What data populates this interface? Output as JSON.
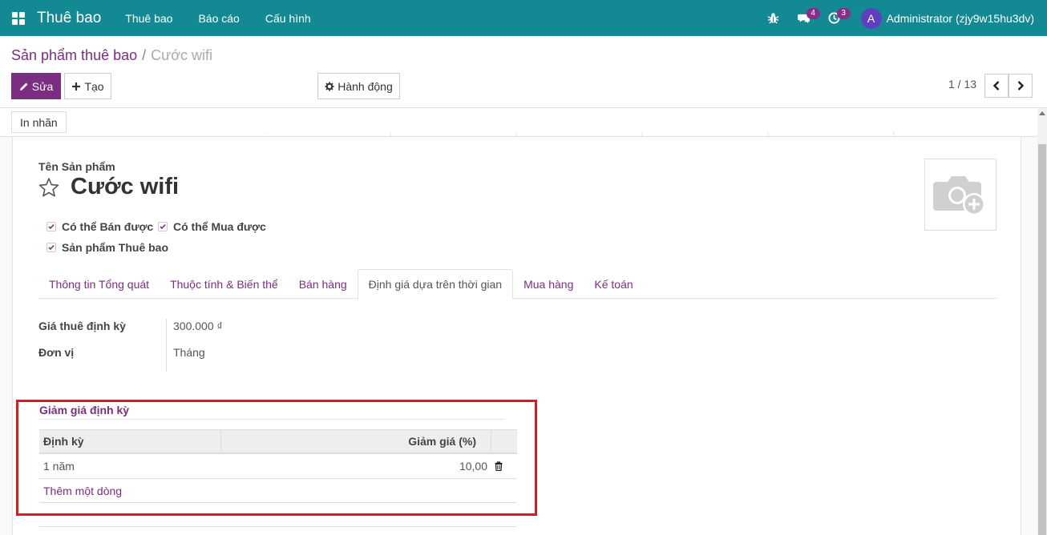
{
  "app": {
    "title": "Thuê bao",
    "menu": [
      "Thuê bao",
      "Báo cáo",
      "Cấu hình"
    ],
    "notifications": {
      "messages": "4",
      "activities": "3"
    },
    "user": {
      "initial": "A",
      "name": "Administrator (zjy9w15hu3dv)"
    },
    "colors": {
      "navbar": "#138a93",
      "primary": "#7c2d82",
      "highlight": "#e3161c"
    }
  },
  "breadcrumb": {
    "parent": "Sản phẩm thuê bao",
    "separator": "/",
    "current": "Cước wifi"
  },
  "toolbar": {
    "edit_label": "Sửa",
    "create_label": "Tạo",
    "action_label": "Hành động"
  },
  "pager": {
    "value": "1 / 13"
  },
  "statusbar": {
    "print_label": "In nhãn"
  },
  "form": {
    "name_label": "Tên Sản phẩm",
    "name": "Cước wifi",
    "checkboxes": [
      {
        "label": "Có thể Bán được",
        "checked": true
      },
      {
        "label": "Có thể Mua được",
        "checked": true
      },
      {
        "label": "Sản phẩm Thuê bao",
        "checked": true
      }
    ],
    "tabs": [
      {
        "label": "Thông tin Tổng quát",
        "active": false
      },
      {
        "label": "Thuộc tính & Biến thể",
        "active": false
      },
      {
        "label": "Bán hàng",
        "active": false
      },
      {
        "label": "Định giá dựa trên thời gian",
        "active": true
      },
      {
        "label": "Mua hàng",
        "active": false
      },
      {
        "label": "Kế toán",
        "active": false
      }
    ],
    "fields": {
      "price_label": "Giá thuê định kỳ",
      "price_value": "300.000 ₫",
      "unit_label": "Đơn vị",
      "unit_value": "Tháng"
    },
    "discount": {
      "title": "Giảm giá định kỳ",
      "columns": [
        "Định kỳ",
        "Giảm giá (%)"
      ],
      "rows": [
        {
          "period": "1 năm",
          "discount": "10,00"
        }
      ],
      "add_line": "Thêm một dòng"
    }
  },
  "icons": [
    "apps-icon",
    "bug-icon",
    "chat-icon",
    "clock-icon",
    "pencil-icon",
    "plus-icon",
    "gear-icon",
    "chevron-left-icon",
    "chevron-right-icon",
    "star-icon",
    "camera-plus-icon",
    "check-icon",
    "trash-icon"
  ]
}
